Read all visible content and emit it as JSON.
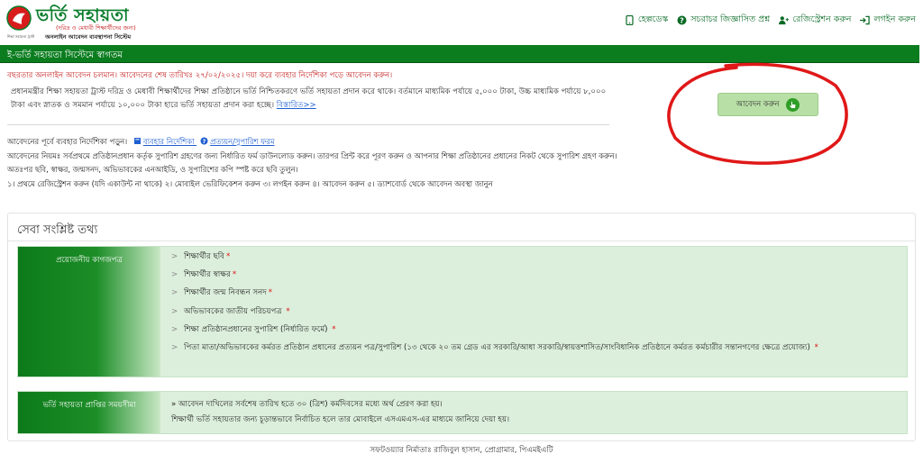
{
  "header": {
    "logo_title": "ভর্তি সহায়তা",
    "logo_tagline": "(দরিদ্র ও মেধাবী শিক্ষার্থীদের জন্য)",
    "logo_motto": "অনলাইন আবেদন ব্যবস্থাপনা সিস্টেম",
    "logo_sub": "শিক্ষা সহায়তা ট্রাস্ট",
    "nav": [
      {
        "label": "হেল্পডেস্ক",
        "icon": "mobile-icon"
      },
      {
        "label": "সচরাচর জিজ্ঞাসিত প্রশ্ন",
        "icon": "question-icon"
      },
      {
        "label": "রেজিস্ট্রেশন করুন",
        "icon": "user-plus-icon"
      },
      {
        "label": "লগইন করুন",
        "icon": "sign-in-icon"
      }
    ]
  },
  "banner": {
    "text": "ই-ভর্তি সহায়তা সিস্টেমে স্বাগতম"
  },
  "notice": {
    "text": "বছরতার অনলাইন আবেদন চলমান। আবেদনের শেষ তারিখঃ ২৭/০২/২০২৫। দয়া করে ব্যবহার নির্দেশিকা পড়ে আবেদন করুন।"
  },
  "intro": {
    "text": "প্রধানমন্ত্রীর শিক্ষা সহায়তা ট্রাস্ট দরিদ্র ও মেধাবী শিক্ষার্থীদের শিক্ষা প্রতিষ্ঠানে ভর্তি নিশ্চিতকরণে ভর্তি সহায়তা প্রদান করে থাকে। বর্তমানে মাধ্যমিক পর্যায়ে ৫,০০০ টাকা, উচ্চ মাধ্যমিক পর্যায়ে ৮,০০০ টাকা এবং স্নাতক ও সমমান পর্যায়ে ১০,০০০ টাকা হারে ভর্তি সহায়তা প্রদান করা হচ্ছে।",
    "more_link": "বিস্তারিত>>"
  },
  "guide": {
    "lead": "আবেদনের পূর্বে ব্যবহার নির্দেশিকা পড়ুন।",
    "manual_link": "ব্যবহার নির্দেশিকা",
    "form_link": "প্রত্যয়ন/সুপারিশ ফরম",
    "rules": "আবেদনের নিয়মঃ সর্বপ্রথমে প্রতিষ্ঠানপ্রধান কর্তৃক সুপারিশ গ্রহণের জন্য নির্ধারিত ফর্ম ডাউনলোড করুন। তারপর প্রিন্ট করে পূরণ করুন ও আপনার শিক্ষা প্রতিষ্ঠানের প্রধানের নিকট থেকে সুপারিশ গ্রহণ করুন। অতঃপর ছবি, স্বাক্ষর, জন্মসনদ, অভিভাবকের এনআইডি, ও সুপারিশের কপি স্পষ্ট করে ছবি তুলুন।",
    "steps": "১। প্রথমে রেজিস্ট্রেশন করুন (যদি একাউন্ট না থাকে) ২। মোবাইল ভেরিফিকেশন করুন ৩। লগইন করুন ৪। আবেদন করুন ৫। ড্যাশবোর্ড থেকে আবেদন অবস্থা জানুন"
  },
  "apply": {
    "label": "আবেদন করুন"
  },
  "services": {
    "title": "সেবা সংশ্লিষ্ট তথ্য",
    "documents_label": "প্রয়োজনীয় কাগজপত্র",
    "documents": [
      "শিক্ষার্থীর ছবি",
      "শিক্ষার্থীর স্বাক্ষর",
      "শিক্ষার্থীর জন্ম নিবন্ধন সনদ",
      "অভিভাবকের জাতীয় পরিচয়পত্র",
      "শিক্ষা প্রতিষ্ঠানপ্রধানের সুপারিশ (নির্ধারিত ফর্মে)",
      "পিতা মাতা/অভিভাবকের কর্মরত প্রতিষ্ঠান প্রধানের প্রত্যয়ন পত্র/সুপারিশ (১৩ থেকে ২০ তম গ্রেড এর সরকারি/আধা সরকারি/স্বায়ত্তশাসিত/সাংবিধানিক প্রতিষ্ঠানে কর্মরত কর্মচারীর সন্তানগণের ক্ষেত্রে প্রযোজ্য)"
    ],
    "required_mark": "*",
    "bullet": ">",
    "time_label": "ভর্তি সহায়তা প্রাপ্তির সময়সীমা",
    "time_line1": "» আবেদন দাখিলের সর্বশেষ তারিখ হতে ৩০ (ত্রিশ) কর্মদিবসের মধ্যে অর্থ প্রেরণ করা হয়।",
    "time_line2": "শিক্ষার্থী ভর্তি সহায়তার জন্য চূড়ান্তভাবে নির্বাচিত হলে তার মোবাইলে এসএমএস-এর মাধ্যমে জানিয়ে দেয়া হয়।"
  },
  "footer": {
    "text": "সফটওয়্যার নির্মাতাঃ রাজিবুল হাসান, প্রোগ্রামার, পিএমইএটি"
  },
  "colors": {
    "brand_green": "#0b7d1f",
    "notice_red": "#c21a1a",
    "link_blue": "#1f5fd1",
    "panel_green": "#dcefdc",
    "annotation_red": "#e01818"
  }
}
